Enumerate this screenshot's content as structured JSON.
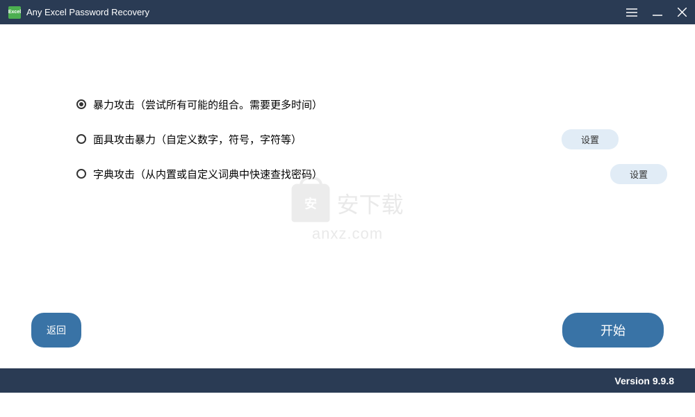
{
  "titlebar": {
    "title": "Any Excel Password Recovery",
    "icon_label": "Excel"
  },
  "options": {
    "brute_force": "暴力攻击（尝试所有可能的组合。需要更多时间）",
    "mask_attack": "面具攻击暴力（自定义数字，符号，字符等）",
    "dictionary_attack": "字典攻击（从内置或自定义词典中快速查找密码）",
    "settings_label": "设置"
  },
  "watermark": {
    "text": "安下载",
    "url": "anxz.com"
  },
  "buttons": {
    "back": "返回",
    "start": "开始"
  },
  "footer": {
    "version": "Version 9.9.8"
  }
}
